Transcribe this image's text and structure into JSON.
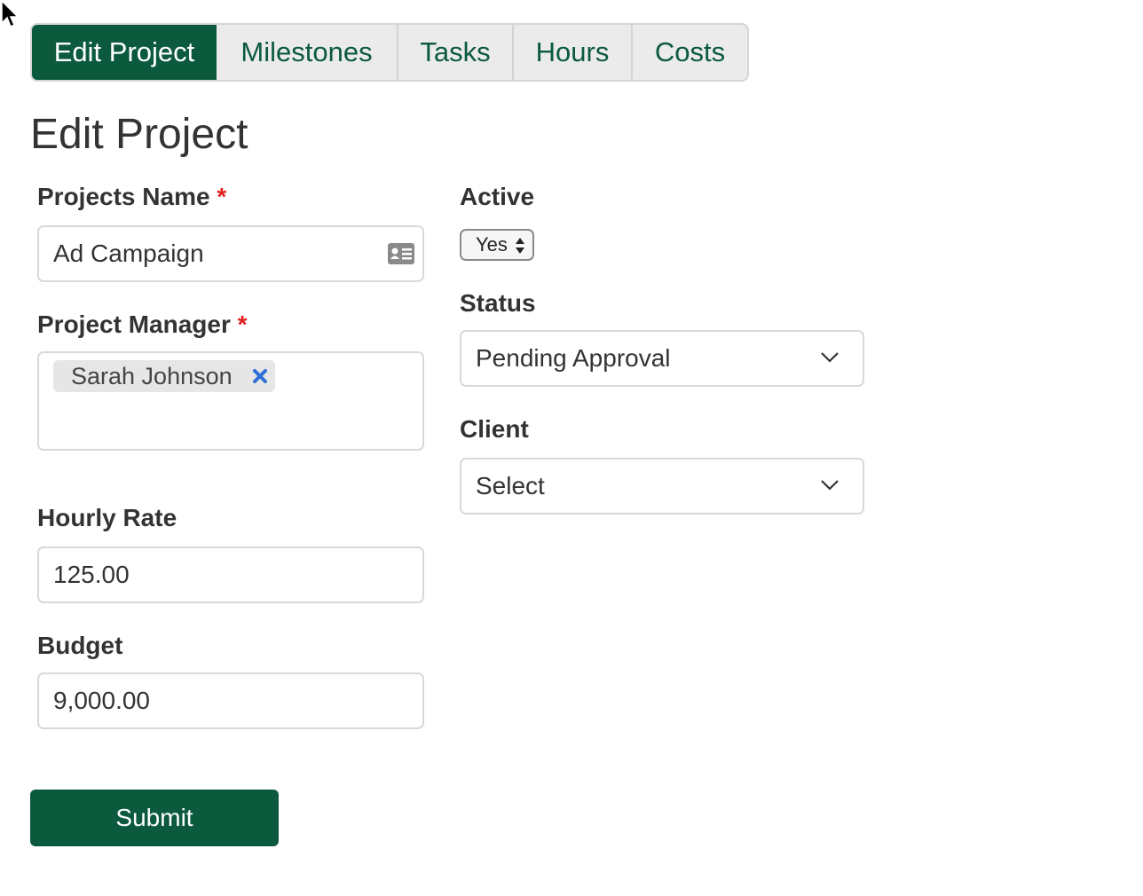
{
  "tabs": [
    {
      "label": "Edit Project",
      "active": true
    },
    {
      "label": "Milestones",
      "active": false
    },
    {
      "label": "Tasks",
      "active": false
    },
    {
      "label": "Hours",
      "active": false
    },
    {
      "label": "Costs",
      "active": false
    }
  ],
  "page_title": "Edit Project",
  "form": {
    "project_name": {
      "label": "Projects Name",
      "required_mark": "*",
      "value": "Ad Campaign",
      "icon": "contact-card-icon"
    },
    "project_manager": {
      "label": "Project Manager",
      "required_mark": "*",
      "tags": [
        "Sarah Johnson"
      ],
      "remove_icon": "close-icon"
    },
    "hourly_rate": {
      "label": "Hourly Rate",
      "value": "125.00"
    },
    "budget": {
      "label": "Budget",
      "value": "9,000.00"
    },
    "active": {
      "label": "Active",
      "value": "Yes"
    },
    "status": {
      "label": "Status",
      "value": "Pending Approval"
    },
    "client": {
      "label": "Client",
      "value": "Select"
    }
  },
  "submit_label": "Submit",
  "colors": {
    "accent": "#0b5a3e",
    "required": "#e02020",
    "tag_remove": "#2f6fd6"
  }
}
